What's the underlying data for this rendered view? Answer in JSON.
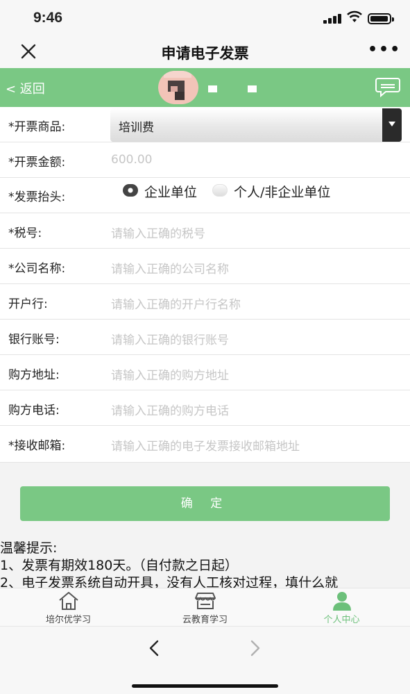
{
  "status": {
    "time": "9:46"
  },
  "nav": {
    "title": "申请电子发票"
  },
  "header": {
    "back_label": "< 返回"
  },
  "form": {
    "product_label": "*开票商品:",
    "product_value": "培训费",
    "amount_label": "*开票金额:",
    "amount_value": "600.00",
    "invoice_title_label": "*发票抬头:",
    "title_options": [
      "企业单位",
      "个人/非企业单位"
    ],
    "title_selected": "企业单位",
    "tax_label": "*税号:",
    "tax_placeholder": "请输入正确的税号",
    "company_label": "*公司名称:",
    "company_placeholder": "请输入正确的公司名称",
    "bank_label": "开户行:",
    "bank_placeholder": "请输入正确的开户行名称",
    "account_label": "银行账号:",
    "account_placeholder": "请输入正确的银行账号",
    "address_label": "购方地址:",
    "address_placeholder": "请输入正确的购方地址",
    "phone_label": "购方电话:",
    "phone_placeholder": "请输入正确的购方电话",
    "email_label": "*接收邮箱:",
    "email_placeholder": "请输入正确的电子发票接收邮箱地址"
  },
  "confirm_label": "确 定",
  "tips": [
    "温馨提示:",
    "1、发票有期效180天。（自付款之日起）",
    "2、电子发票系统自动开具，没有人工核对过程，填什么就"
  ],
  "tabbar": {
    "items": [
      {
        "label": "培尔优学习",
        "icon": "home-icon"
      },
      {
        "label": "云教育学习",
        "icon": "store-icon"
      },
      {
        "label": "个人中心",
        "icon": "person-icon"
      }
    ],
    "active": "个人中心",
    "active_color": "#6cc07a"
  },
  "colors": {
    "brand_green": "#7ac884"
  }
}
